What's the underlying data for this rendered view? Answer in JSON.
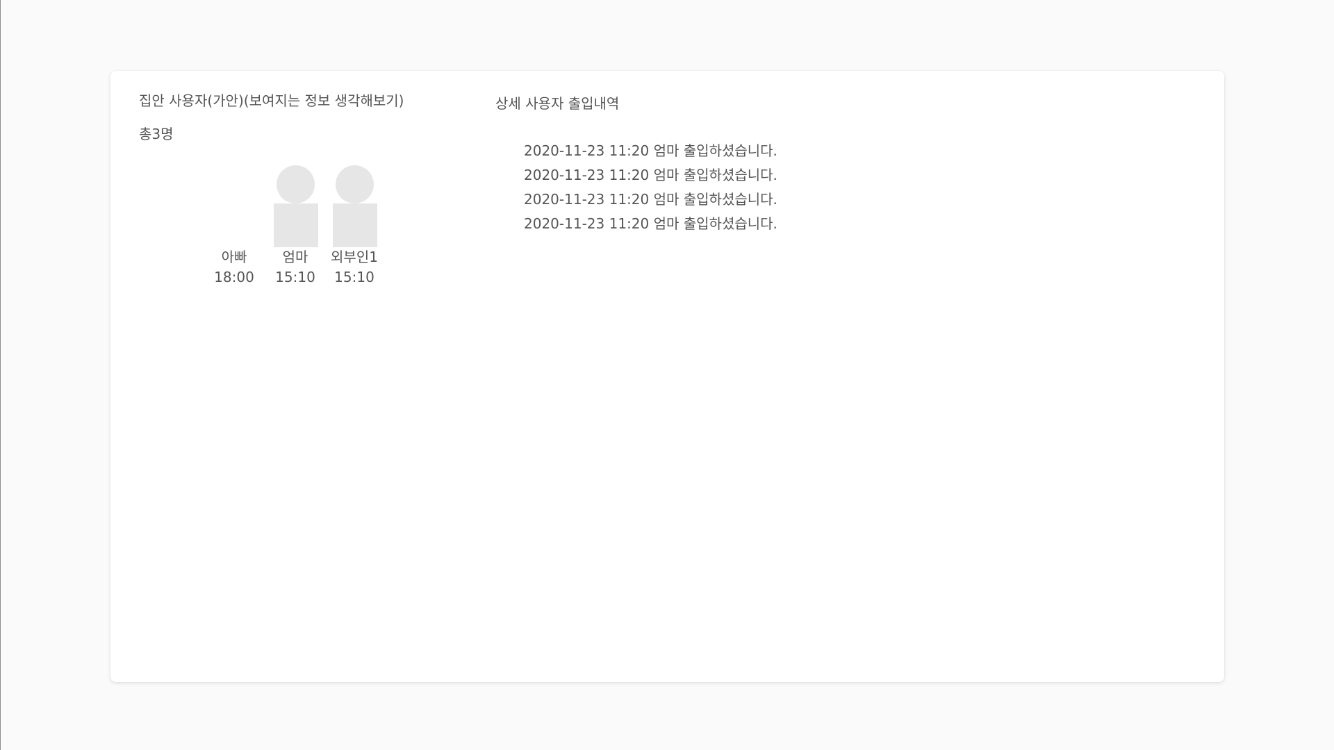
{
  "home_users": {
    "title": "집안 사용자(가안)(보여지는 정보 생각해보기)",
    "total": "총3명",
    "users": [
      {
        "name": "아빠",
        "time": "18:00"
      },
      {
        "name": "엄마",
        "time": "15:10"
      },
      {
        "name": "외부인1",
        "time": "15:10"
      }
    ]
  },
  "detail": {
    "title": "상세 사용자 출입내역",
    "logs": [
      "2020-11-23 11:20 엄마 출입하셨습니다.",
      "2020-11-23 11:20 엄마 출입하셨습니다.",
      "2020-11-23 11:20 엄마 출입하셨습니다.",
      "2020-11-23 11:20 엄마 출입하셨습니다."
    ]
  },
  "colors": {
    "page_background": "#fafafa",
    "card_background": "#ffffff",
    "placeholder": "#e6e6e6",
    "text": "#555555"
  }
}
